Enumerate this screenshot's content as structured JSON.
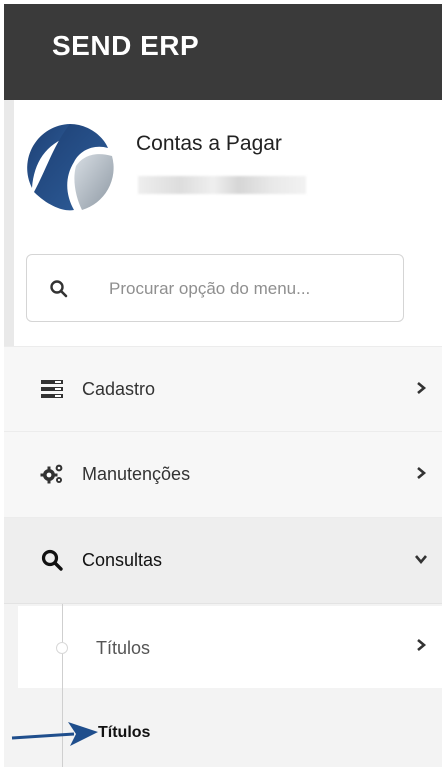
{
  "app": {
    "title": "SEND ERP"
  },
  "profile": {
    "name": "Contas a Pagar"
  },
  "search": {
    "placeholder": "Procurar opção do menu..."
  },
  "menu": {
    "items": [
      {
        "label": "Cadastro",
        "icon": "list-icon"
      },
      {
        "label": "Manutenções",
        "icon": "gears-icon"
      },
      {
        "label": "Consultas",
        "icon": "search-icon",
        "expanded": true
      }
    ]
  },
  "submenu": {
    "label": "Títulos"
  },
  "leaf": {
    "label": "Títulos"
  },
  "colors": {
    "header": "#3a3a3a",
    "annotation_arrow": "#1f4e8c"
  }
}
